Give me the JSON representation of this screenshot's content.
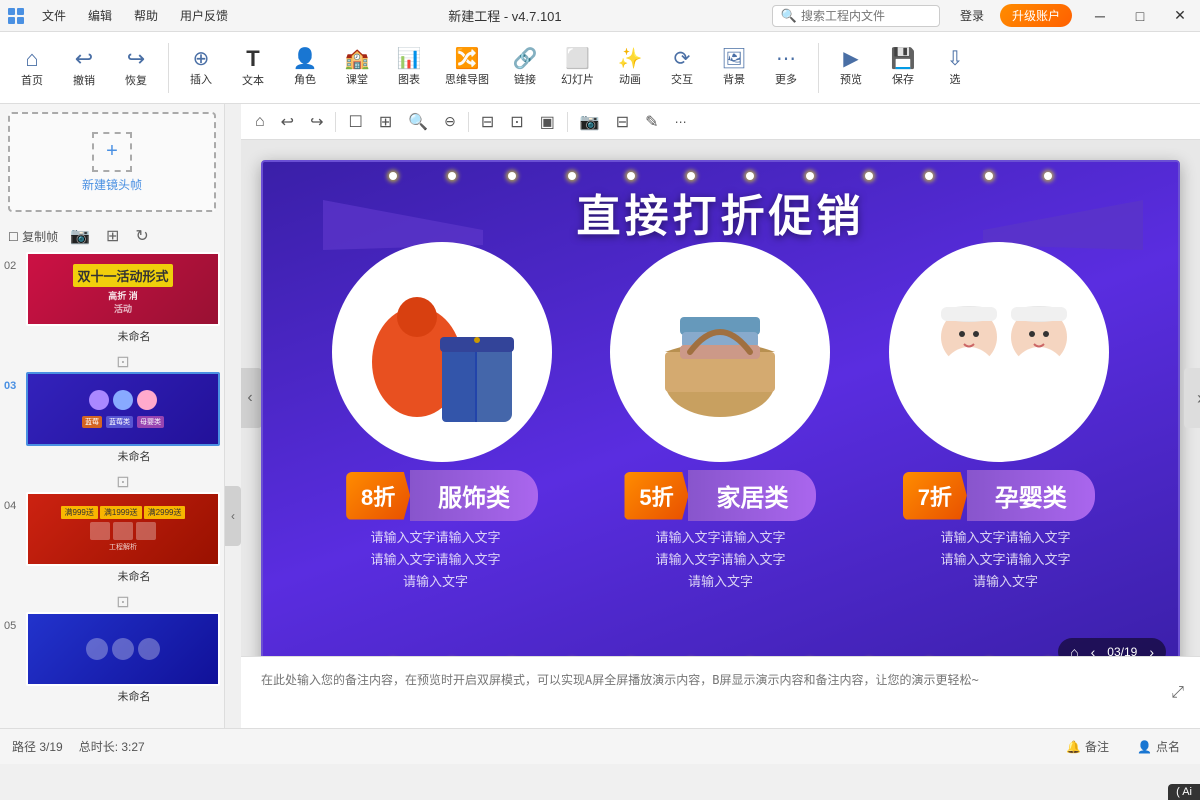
{
  "app": {
    "title": "新建工程 - v4.7.101",
    "search_placeholder": "搜索工程内文件"
  },
  "titlebar": {
    "icon": "▦",
    "menus": [
      "文件",
      "编辑",
      "帮助",
      "用户反馈"
    ],
    "login": "登录",
    "upgrade": "升级账户",
    "minimize": "─",
    "maximize": "□",
    "close": "✕"
  },
  "toolbar": {
    "items": [
      {
        "label": "首页",
        "icon": "⌂"
      },
      {
        "label": "撤销",
        "icon": "↩"
      },
      {
        "label": "恢复",
        "icon": "↪"
      },
      {
        "label": "插入",
        "icon": "⊕"
      },
      {
        "label": "文本",
        "icon": "T"
      },
      {
        "label": "角色",
        "icon": "👤"
      },
      {
        "label": "课堂",
        "icon": "🏫"
      },
      {
        "label": "图表",
        "icon": "📊"
      },
      {
        "label": "思维导图",
        "icon": "🔀"
      },
      {
        "label": "链接",
        "icon": "🔗"
      },
      {
        "label": "幻灯片",
        "icon": "⬜"
      },
      {
        "label": "动画",
        "icon": "✨"
      },
      {
        "label": "交互",
        "icon": "⟳"
      },
      {
        "label": "背景",
        "icon": "🖼"
      },
      {
        "label": "更多",
        "icon": "⋯"
      },
      {
        "label": "预览",
        "icon": "▶"
      },
      {
        "label": "保存",
        "icon": "💾"
      },
      {
        "label": "选",
        "icon": "⇩"
      }
    ]
  },
  "sidebar": {
    "new_frame_label": "新建镜头帧",
    "frame_actions": [
      "复制帧",
      "📷",
      "⊞",
      "↻"
    ],
    "slides": [
      {
        "num": "02",
        "name": "未命名",
        "active": false
      },
      {
        "num": "03",
        "name": "未命名",
        "active": true
      },
      {
        "num": "04",
        "name": "未命名",
        "active": false
      },
      {
        "num": "05",
        "name": "未命名",
        "active": false
      }
    ]
  },
  "canvas_tools": [
    "⌂",
    "↩",
    "↪",
    "☐",
    "▥",
    "🔍+",
    "🔍-",
    "⊟",
    "⊞",
    "▤",
    "⊡",
    "📷",
    "▣",
    "⊟",
    "✎"
  ],
  "slide": {
    "title": "直接打折促销",
    "products": [
      {
        "discount": "8折",
        "category": "服饰类",
        "desc": "请输入文字请输入文字\n请输入文字请输入文字\n请输入文字"
      },
      {
        "discount": "5折",
        "category": "家居类",
        "desc": "请输入文字请输入文字\n请输入文字请输入文字\n请输入文字"
      },
      {
        "discount": "7折",
        "category": "孕婴类",
        "desc": "请输入文字请输入文字\n请输入文字请输入文字\n请输入文字"
      }
    ]
  },
  "slide_nav": {
    "current": "03",
    "total": "19",
    "text": "03/19"
  },
  "notes": {
    "placeholder": "在此处输入您的备注内容，在预览时开启双屏模式，可以实现A屏全屏播放演示内容，B屏显示演示内容和备注内容，让您的演示更轻松~"
  },
  "statusbar": {
    "path": "路径 3/19",
    "duration": "总时长: 3:27",
    "notes_btn": "备注",
    "rollcall_btn": "点名",
    "ai_badge": "( Ai"
  }
}
